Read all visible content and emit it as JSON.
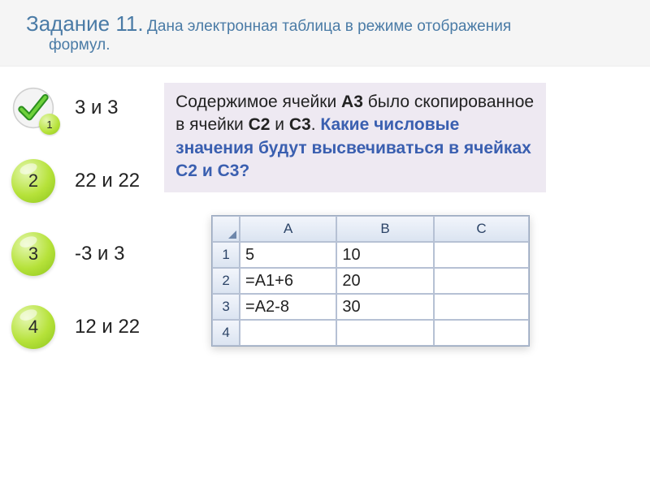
{
  "header": {
    "title_strong": "Задание 11.",
    "title_rest1": "Дана электронная таблица в режиме отображения",
    "title_rest2": "формул."
  },
  "options": [
    {
      "num": "1",
      "label": "3 и 3",
      "correct": true
    },
    {
      "num": "2",
      "label": "22 и 22",
      "correct": false
    },
    {
      "num": "3",
      "label": "-3 и 3",
      "correct": false
    },
    {
      "num": "4",
      "label": "12 и 22",
      "correct": false
    }
  ],
  "question": {
    "t1": "Содержимое ячейки ",
    "b1a": "А3",
    "t2": " было скопированное в ячейки ",
    "b1b": "С2",
    "t3": " и ",
    "b1c": "С3",
    "t4": ". ",
    "b2": "Какие числовые значения будут высвечиваться в ячейках С2 и С3?"
  },
  "spreadsheet": {
    "col_headers": [
      "A",
      "B",
      "C"
    ],
    "rows": [
      {
        "r": "1",
        "A": "5",
        "B": "10",
        "C": ""
      },
      {
        "r": "2",
        "A": "=A1+6",
        "B": "20",
        "C": ""
      },
      {
        "r": "3",
        "A": "=A2-8",
        "B": "30",
        "C": ""
      },
      {
        "r": "4",
        "A": "",
        "B": "",
        "C": ""
      }
    ]
  }
}
